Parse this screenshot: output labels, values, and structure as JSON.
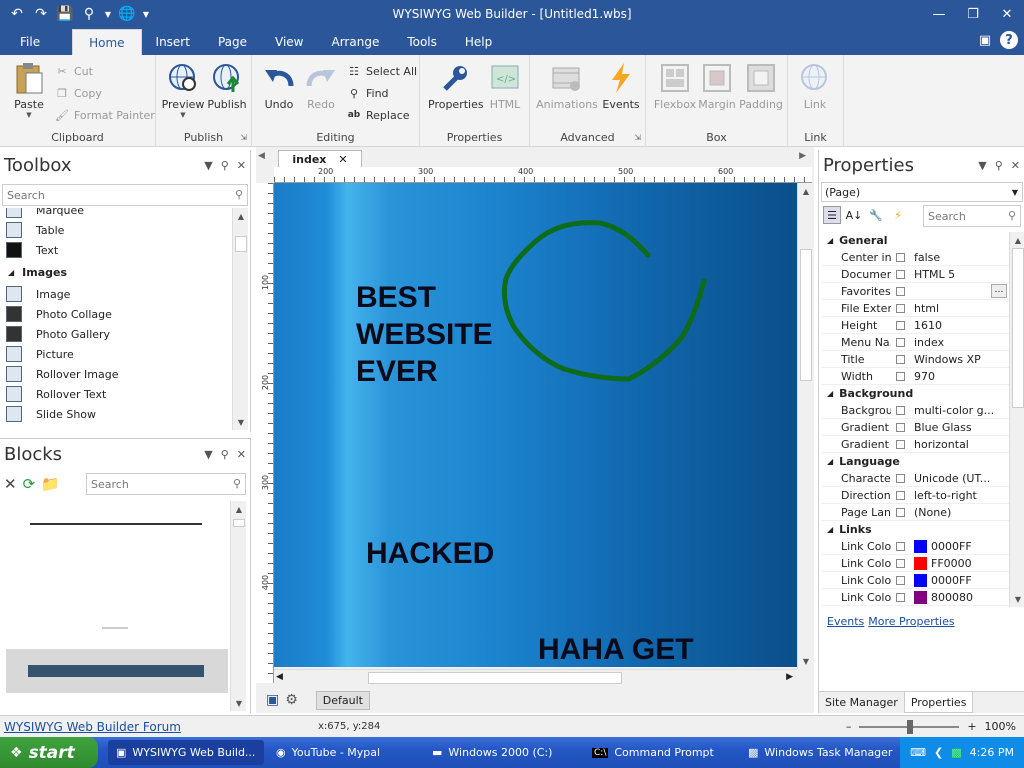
{
  "window": {
    "title": "WYSIWYG Web Builder - [Untitled1.wbs]"
  },
  "menu_tabs": [
    "File",
    "Home",
    "Insert",
    "Page",
    "View",
    "Arrange",
    "Tools",
    "Help"
  ],
  "ribbon": {
    "clipboard": {
      "paste": "Paste",
      "cut": "Cut",
      "copy": "Copy",
      "format_painter": "Format Painter",
      "label": "Clipboard"
    },
    "publish": {
      "preview": "Preview",
      "publish": "Publish",
      "label": "Publish"
    },
    "editing": {
      "undo": "Undo",
      "redo": "Redo",
      "select_all": "Select All",
      "find": "Find",
      "replace": "Replace",
      "label": "Editing"
    },
    "properties": {
      "properties": "Properties",
      "html": "HTML",
      "label": "Properties"
    },
    "advanced": {
      "animations": "Animations",
      "events": "Events",
      "label": "Advanced"
    },
    "box": {
      "flexbox": "Flexbox",
      "margin": "Margin",
      "padding": "Padding",
      "label": "Box"
    },
    "link": {
      "link": "Link",
      "label": "Link"
    }
  },
  "toolbox": {
    "title": "Toolbox",
    "search_placeholder": "Search",
    "items_top": [
      "Marquee",
      "Table",
      "Text"
    ],
    "category": "Images",
    "items_images": [
      "Image",
      "Photo Collage",
      "Photo Gallery",
      "Picture",
      "Rollover Image",
      "Rollover Text",
      "Slide Show"
    ]
  },
  "blocks": {
    "title": "Blocks",
    "search_placeholder": "Search"
  },
  "editor": {
    "tab": "index",
    "ruler_h": [
      "200",
      "300",
      "400",
      "500",
      "600"
    ],
    "ruler_v": [
      "100",
      "200",
      "300",
      "400"
    ],
    "canvas_text": {
      "line1": "BEST",
      "line2": "WEBSITE",
      "line3": "EVER",
      "hacked": "HACKED",
      "haha": "HAHA GET"
    },
    "default_button": "Default"
  },
  "properties": {
    "title": "Properties",
    "selector": "(Page)",
    "search_placeholder": "Search",
    "categories": [
      {
        "name": "General",
        "rows": [
          {
            "name": "Center in ...",
            "value": "false"
          },
          {
            "name": "Documen...",
            "value": "HTML 5"
          },
          {
            "name": "Favorites ...",
            "value": ""
          },
          {
            "name": "File Exten...",
            "value": "html"
          },
          {
            "name": "Height",
            "value": "1610"
          },
          {
            "name": "Menu Na...",
            "value": "index"
          },
          {
            "name": "Title",
            "value": "Windows XP"
          },
          {
            "name": "Width",
            "value": "970"
          }
        ]
      },
      {
        "name": "Background",
        "rows": [
          {
            "name": "Backgrou...",
            "value": "multi-color g..."
          },
          {
            "name": "Gradient ...",
            "value": "Blue Glass"
          },
          {
            "name": "Gradient ...",
            "value": "horizontal"
          }
        ]
      },
      {
        "name": "Language",
        "rows": [
          {
            "name": "Character...",
            "value": "Unicode (UT..."
          },
          {
            "name": "Direction",
            "value": "left-to-right"
          },
          {
            "name": "Page Lan...",
            "value": "(None)"
          }
        ]
      },
      {
        "name": "Links",
        "rows": [
          {
            "name": "Link Color",
            "value": "0000FF",
            "swatch": "#0000FF"
          },
          {
            "name": "Link Colo...",
            "value": "FF0000",
            "swatch": "#FF0000"
          },
          {
            "name": "Link Colo...",
            "value": "0000FF",
            "swatch": "#0000FF"
          },
          {
            "name": "Link Colo...",
            "value": "800080",
            "swatch": "#800080"
          }
        ]
      }
    ],
    "links": {
      "events": "Events",
      "more": "More Properties"
    },
    "tabs": [
      "Site Manager",
      "Properties"
    ]
  },
  "status": {
    "forum_link": "WYSIWYG Web Builder Forum",
    "coords": "x:675, y:284",
    "zoom": "100%"
  },
  "taskbar": {
    "start": "start",
    "items": [
      "WYSIWYG Web Build...",
      "YouTube - Mypal",
      "Windows 2000 (C:)",
      "Command Prompt",
      "Windows Task Manager"
    ],
    "clock": "4:26 PM"
  },
  "colors": {
    "accent": "#2b579a",
    "link": "#1a4fa0",
    "scribble": "#0d6b1a"
  }
}
